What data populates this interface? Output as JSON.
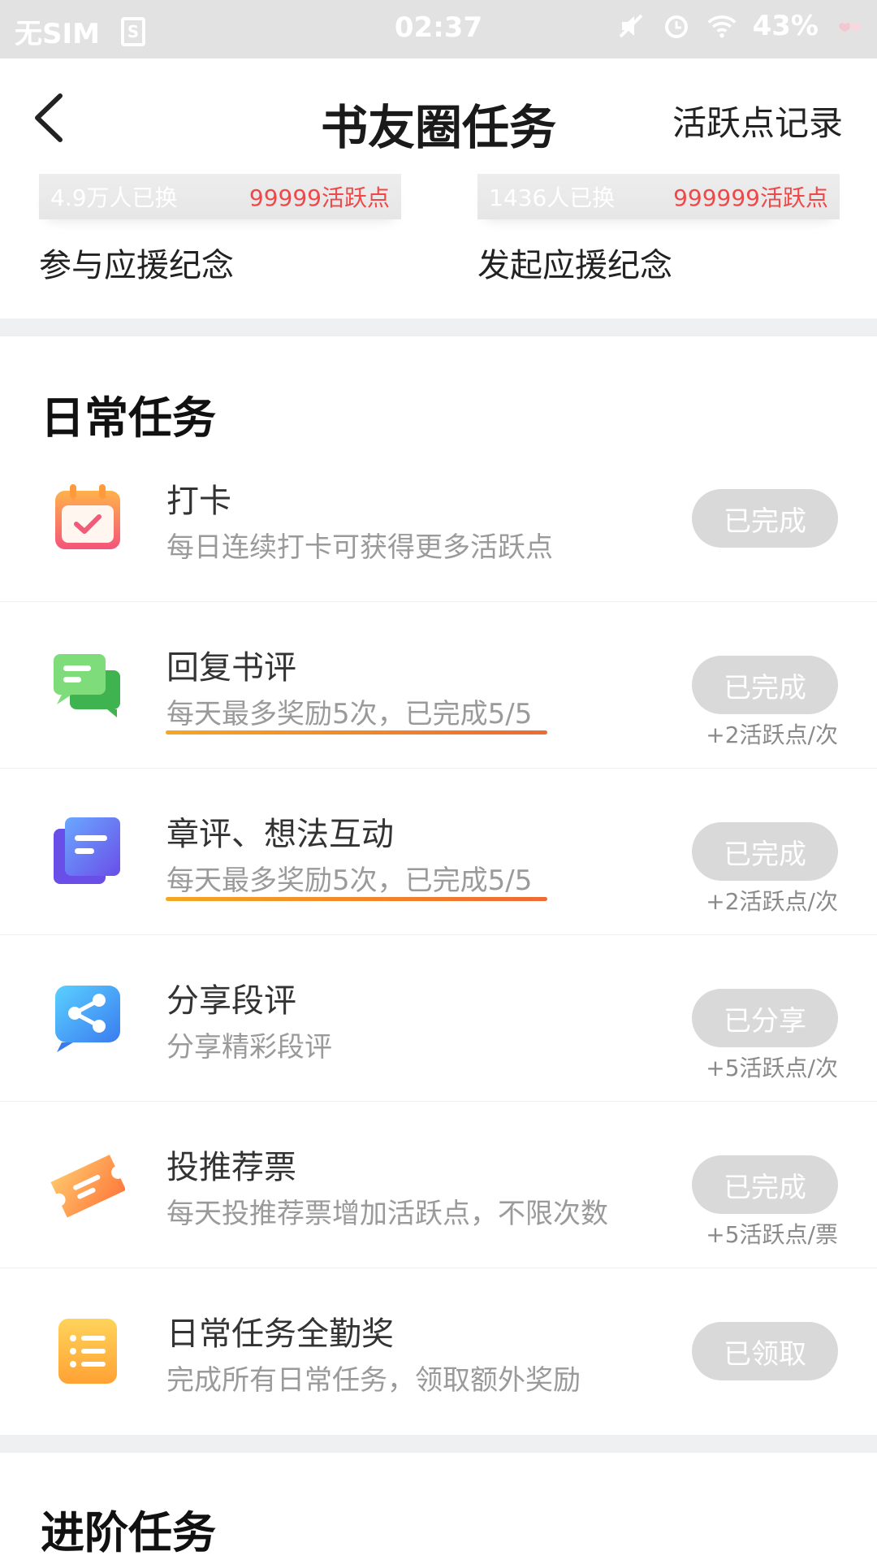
{
  "status_bar": {
    "carrier": "无SIM",
    "sim_icon": "sim-card-icon",
    "time": "02:37",
    "battery": "43%"
  },
  "header": {
    "title": "书友圈任务",
    "right_link": "活跃点记录"
  },
  "support": [
    {
      "count": "4.9万人已换",
      "points": "99999活跃点",
      "label": "参与应援纪念"
    },
    {
      "count": "1436人已换",
      "points": "999999活跃点",
      "label": "发起应援纪念"
    }
  ],
  "daily": {
    "title": "日常任务",
    "tasks": [
      {
        "title": "打卡",
        "desc": "每日连续打卡可获得更多活跃点",
        "status": "已完成",
        "reward": ""
      },
      {
        "title": "回复书评",
        "desc": "每天最多奖励5次，已完成5/5",
        "status": "已完成",
        "reward": "+2活跃点/次"
      },
      {
        "title": "章评、想法互动",
        "desc": "每天最多奖励5次，已完成5/5",
        "status": "已完成",
        "reward": "+2活跃点/次"
      },
      {
        "title": "分享段评",
        "desc": "分享精彩段评",
        "status": "已分享",
        "reward": "+5活跃点/次"
      },
      {
        "title": "投推荐票",
        "desc": "每天投推荐票增加活跃点，不限次数",
        "status": "已完成",
        "reward": "+5活跃点/票"
      },
      {
        "title": "日常任务全勤奖",
        "desc": "完成所有日常任务，领取额外奖励",
        "status": "已领取",
        "reward": ""
      }
    ]
  },
  "advanced": {
    "title": "进阶任务"
  },
  "colors": {
    "accent_red": "#f04848",
    "button_gray": "#d9d9d9",
    "underline_start": "#f6a623",
    "underline_end": "#ee6a32"
  }
}
